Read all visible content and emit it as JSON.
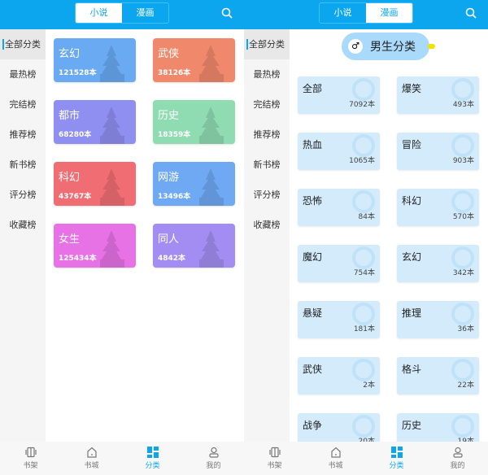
{
  "tabs": [
    "小说",
    "漫画"
  ],
  "sidebar": [
    "全部分类",
    "最热榜",
    "完结榜",
    "推荐榜",
    "新书榜",
    "评分榜",
    "收藏榜"
  ],
  "novel_categories": [
    {
      "name": "玄幻",
      "count": "121528本",
      "color": "#6aaaf3"
    },
    {
      "name": "武侠",
      "count": "38126本",
      "color": "#f0896c"
    },
    {
      "name": "都市",
      "count": "68280本",
      "color": "#8e8ff0"
    },
    {
      "name": "历史",
      "count": "18359本",
      "color": "#8fdcb3"
    },
    {
      "name": "科幻",
      "count": "43767本",
      "color": "#f06e73"
    },
    {
      "name": "网游",
      "count": "13496本",
      "color": "#6fa9f4"
    },
    {
      "name": "女生",
      "count": "125434本",
      "color": "#e772e5"
    },
    {
      "name": "同人",
      "count": "4842本",
      "color": "#a38df2"
    }
  ],
  "comic": {
    "section_title": "男生分类",
    "section_icon": "male-icon",
    "categories": [
      {
        "name": "全部",
        "count": "7092本"
      },
      {
        "name": "爆笑",
        "count": "493本"
      },
      {
        "name": "热血",
        "count": "1065本"
      },
      {
        "name": "冒险",
        "count": "903本"
      },
      {
        "name": "恐怖",
        "count": "84本"
      },
      {
        "name": "科幻",
        "count": "570本"
      },
      {
        "name": "魔幻",
        "count": "754本"
      },
      {
        "name": "玄幻",
        "count": "342本"
      },
      {
        "name": "悬疑",
        "count": "181本"
      },
      {
        "name": "推理",
        "count": "36本"
      },
      {
        "name": "武侠",
        "count": "2本"
      },
      {
        "name": "格斗",
        "count": "22本"
      },
      {
        "name": "战争",
        "count": "20本"
      },
      {
        "name": "历史",
        "count": "19本"
      }
    ]
  },
  "nav": [
    "书架",
    "书城",
    "分类",
    "我的"
  ],
  "accent": "#0ba6ee"
}
